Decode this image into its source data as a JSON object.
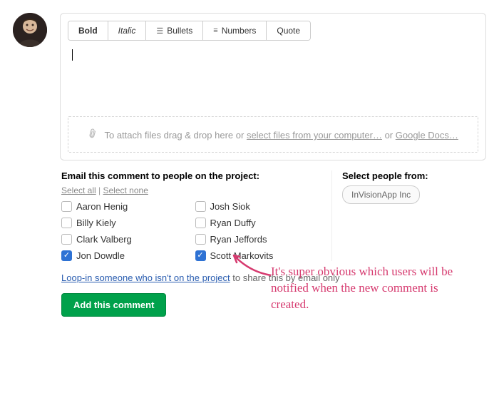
{
  "toolbar": {
    "bold": "Bold",
    "italic": "Italic",
    "bullets": "Bullets",
    "numbers": "Numbers",
    "quote": "Quote"
  },
  "attach": {
    "prefix": "To attach files drag & drop here or ",
    "select_link": "select files from your computer…",
    "middle": " or ",
    "google_link": "Google Docs…"
  },
  "email_section": {
    "heading": "Email this comment to people on the project:",
    "select_all": "Select all",
    "separator": " | ",
    "select_none": "Select none"
  },
  "people": [
    {
      "name": "Aaron Henig",
      "checked": false
    },
    {
      "name": "Josh Siok",
      "checked": false
    },
    {
      "name": "Billy Kiely",
      "checked": false
    },
    {
      "name": "Ryan Duffy",
      "checked": false
    },
    {
      "name": "Clark Valberg",
      "checked": false
    },
    {
      "name": "Ryan Jeffords",
      "checked": false
    },
    {
      "name": "Jon Dowdle",
      "checked": true
    },
    {
      "name": "Scott Markovits",
      "checked": true
    }
  ],
  "select_from": {
    "heading": "Select people from:",
    "org": "InVisionApp Inc"
  },
  "loop": {
    "link": "Loop-in someone who isn't on the project",
    "suffix": " to share this by email only"
  },
  "submit": "Add this comment",
  "annotation": "It's super obvious which users will be notified when the new comment is created."
}
